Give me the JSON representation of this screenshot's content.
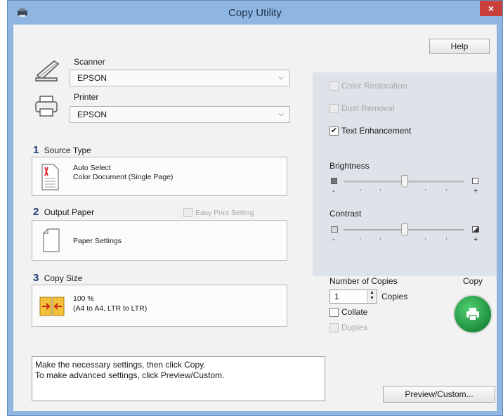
{
  "window": {
    "title": "Copy Utility",
    "close_glyph": "×",
    "colors": {
      "titlebar": "#8fb6e0",
      "close": "#c9413a"
    }
  },
  "toolbar": {
    "help_label": "Help"
  },
  "scanner": {
    "label": "Scanner",
    "value": "EPSON",
    "icon": "scanner-icon"
  },
  "printer": {
    "label": "Printer",
    "value": "EPSON",
    "icon": "printer-icon"
  },
  "source_type": {
    "number": "1",
    "label": "Source Type",
    "line1": "Auto Select",
    "line2": "Color Document (Single Page)"
  },
  "output_paper": {
    "number": "2",
    "label": "Output Paper",
    "easy_print_label": "Easy Print Setting",
    "settings_text": "Paper Settings"
  },
  "copy_size": {
    "number": "3",
    "label": "Copy Size",
    "line1": "100 %",
    "line2": "(A4 to A4, LTR to LTR)"
  },
  "options": {
    "color_restoration": {
      "label": "Color Restoration",
      "checked": false,
      "enabled": false
    },
    "dust_removal": {
      "label": "Dust Removal",
      "checked": false,
      "enabled": false
    },
    "text_enhancement": {
      "label": "Text Enhancement",
      "checked": true,
      "enabled": true,
      "check_glyph": "✔"
    }
  },
  "brightness": {
    "label": "Brightness",
    "minus": "-",
    "plus": "+",
    "level": 0.5
  },
  "contrast": {
    "label": "Contrast",
    "minus": "-",
    "plus": "+",
    "level": 0.5
  },
  "copies": {
    "label": "Number of Copies",
    "value": "1",
    "unit_label": "Copies",
    "collate_label": "Collate",
    "collate_checked": false,
    "duplex_label": "Duplex",
    "duplex_enabled": false
  },
  "copy_button": {
    "label": "Copy",
    "color": "#1e8f3c"
  },
  "status": {
    "line1": "Make the necessary settings, then click Copy.",
    "line2": "To make advanced settings, click Preview/Custom."
  },
  "preview_button": {
    "label": "Preview/Custom..."
  }
}
